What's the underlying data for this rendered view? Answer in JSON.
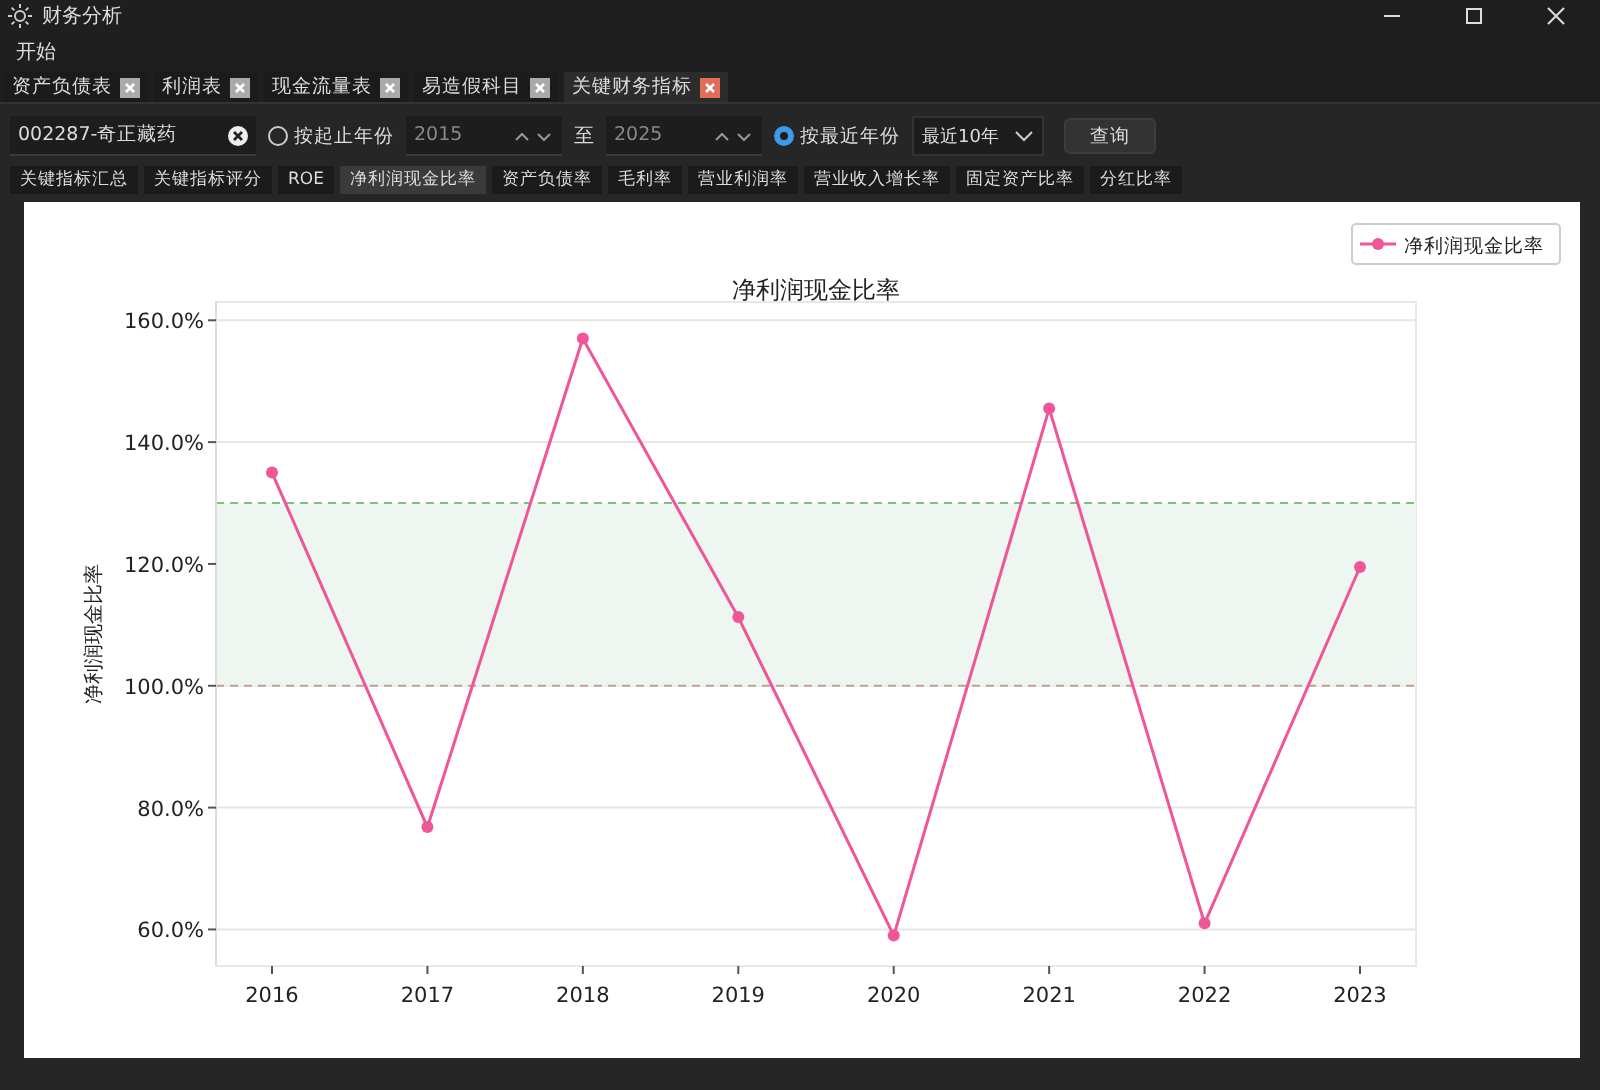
{
  "window": {
    "title": "财务分析"
  },
  "menu": [
    "开始"
  ],
  "doc_tabs": [
    {
      "label": "资产负债表",
      "selected": false
    },
    {
      "label": "利润表",
      "selected": false
    },
    {
      "label": "现金流量表",
      "selected": false
    },
    {
      "label": "易造假科目",
      "selected": false
    },
    {
      "label": "关键财务指标",
      "selected": true
    }
  ],
  "toolbar": {
    "stock": "002287-奇正藏药",
    "range_option": {
      "label": "按起止年份",
      "selected": false
    },
    "from_year": "2015",
    "to_label": "至",
    "to_year": "2025",
    "recent_option": {
      "label": "按最近年份",
      "selected": true
    },
    "recent_value": "最近10年",
    "query_button": "查询"
  },
  "sub_tabs": [
    {
      "label": "关键指标汇总",
      "selected": false
    },
    {
      "label": "关键指标评分",
      "selected": false
    },
    {
      "label": "ROE",
      "selected": false
    },
    {
      "label": "净利润现金比率",
      "selected": true
    },
    {
      "label": "资产负债率",
      "selected": false
    },
    {
      "label": "毛利率",
      "selected": false
    },
    {
      "label": "营业利润率",
      "selected": false
    },
    {
      "label": "营业收入增长率",
      "selected": false
    },
    {
      "label": "固定资产比率",
      "selected": false
    },
    {
      "label": "分红比率",
      "selected": false
    }
  ],
  "chart_data": {
    "type": "line",
    "title": "净利润现金比率",
    "ylabel": "净利润现金比率",
    "categories": [
      "2016",
      "2017",
      "2018",
      "2019",
      "2020",
      "2021",
      "2022",
      "2023"
    ],
    "series": [
      {
        "name": "净利润现金比率",
        "color": "#f0559a",
        "marker": "o",
        "values": [
          135.0,
          76.8,
          157.0,
          111.3,
          59.0,
          145.5,
          61.0,
          119.5
        ]
      }
    ],
    "ylim": [
      54,
      163
    ],
    "yticks": [
      {
        "value": 60,
        "label": "60.0%"
      },
      {
        "value": 80,
        "label": "80.0%"
      },
      {
        "value": 100,
        "label": "100.0%"
      },
      {
        "value": 120,
        "label": "120.0%"
      },
      {
        "value": 140,
        "label": "140.0%"
      },
      {
        "value": 160,
        "label": "160.0%"
      }
    ],
    "grid": true,
    "bands": [
      {
        "axis": "y",
        "from": 100,
        "to": 130,
        "color": "#edf6f0"
      }
    ],
    "ref_lines": [
      {
        "axis": "y",
        "value": 130,
        "color": "#7bc47f"
      },
      {
        "axis": "y",
        "value": 100,
        "color": "#c4a090"
      }
    ]
  }
}
